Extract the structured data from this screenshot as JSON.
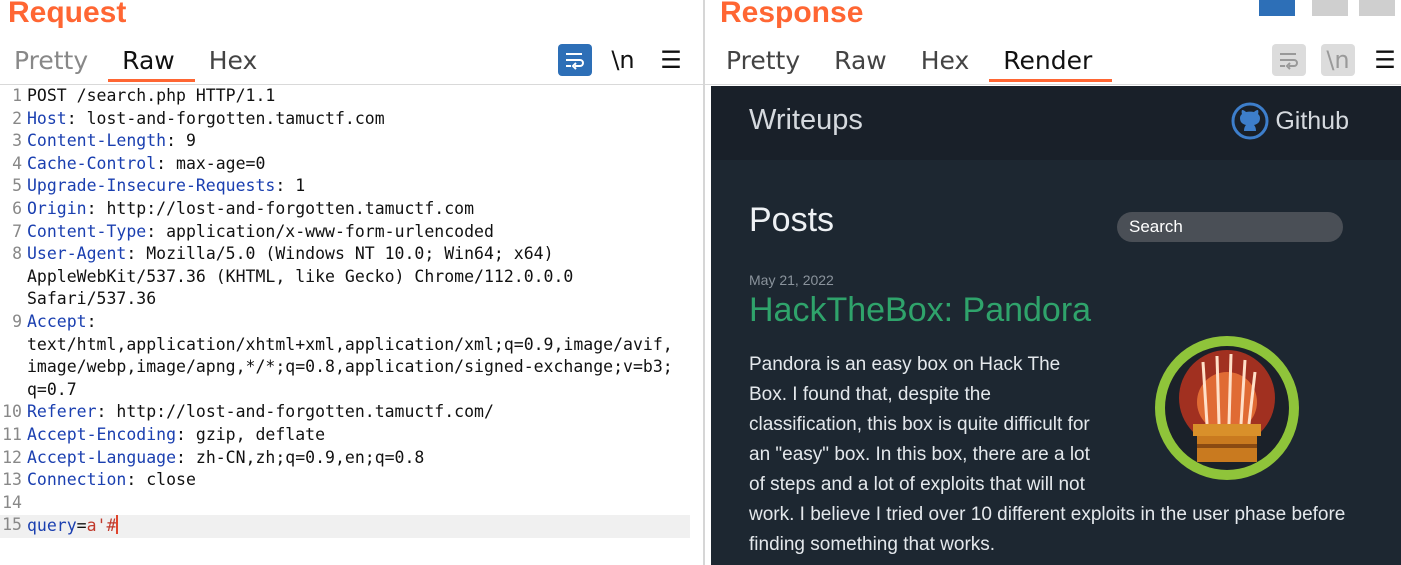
{
  "request": {
    "title": "Request",
    "tabs": [
      "Pretty",
      "Raw",
      "Hex"
    ],
    "active_tab": "Raw",
    "tools": {
      "wrap_icon": "wrap-lines-icon",
      "newline_label": "\\n",
      "menu_icon": "hamburger-menu-icon"
    },
    "lines": [
      {
        "n": "1",
        "parts": [
          [
            "",
            "POST /search.php HTTP/1.1"
          ]
        ]
      },
      {
        "n": "2",
        "parts": [
          [
            "h",
            "Host"
          ],
          [
            "",
            ": lost-and-forgotten.tamuctf.com"
          ]
        ]
      },
      {
        "n": "3",
        "parts": [
          [
            "h",
            "Content-Length"
          ],
          [
            "",
            ": 9"
          ]
        ]
      },
      {
        "n": "4",
        "parts": [
          [
            "h",
            "Cache-Control"
          ],
          [
            "",
            ": max-age=0"
          ]
        ]
      },
      {
        "n": "5",
        "parts": [
          [
            "h",
            "Upgrade-Insecure-Requests"
          ],
          [
            "",
            ": 1"
          ]
        ]
      },
      {
        "n": "6",
        "parts": [
          [
            "h",
            "Origin"
          ],
          [
            "",
            ": http://lost-and-forgotten.tamuctf.com"
          ]
        ]
      },
      {
        "n": "7",
        "parts": [
          [
            "h",
            "Content-Type"
          ],
          [
            "",
            ": application/x-www-form-urlencoded"
          ]
        ]
      },
      {
        "n": "8",
        "parts": [
          [
            "h",
            "User-Agent"
          ],
          [
            "",
            ": Mozilla/5.0 (Windows NT 10.0; Win64; x64)"
          ]
        ]
      },
      {
        "n": "",
        "parts": [
          [
            "",
            "AppleWebKit/537.36 (KHTML, like Gecko) Chrome/112.0.0.0"
          ]
        ]
      },
      {
        "n": "",
        "parts": [
          [
            "",
            "Safari/537.36"
          ]
        ]
      },
      {
        "n": "9",
        "parts": [
          [
            "h",
            "Accept"
          ],
          [
            "",
            ":"
          ]
        ]
      },
      {
        "n": "",
        "parts": [
          [
            "",
            "text/html,application/xhtml+xml,application/xml;q=0.9,image/avif,"
          ]
        ]
      },
      {
        "n": "",
        "parts": [
          [
            "",
            "image/webp,image/apng,*/*;q=0.8,application/signed-exchange;v=b3;"
          ]
        ]
      },
      {
        "n": "",
        "parts": [
          [
            "",
            "q=0.7"
          ]
        ]
      },
      {
        "n": "10",
        "parts": [
          [
            "h",
            "Referer"
          ],
          [
            "",
            ": http://lost-and-forgotten.tamuctf.com/"
          ]
        ]
      },
      {
        "n": "11",
        "parts": [
          [
            "h",
            "Accept-Encoding"
          ],
          [
            "",
            ": gzip, deflate"
          ]
        ]
      },
      {
        "n": "12",
        "parts": [
          [
            "h",
            "Accept-Language"
          ],
          [
            "",
            ": zh-CN,zh;q=0.9,en;q=0.8"
          ]
        ]
      },
      {
        "n": "13",
        "parts": [
          [
            "h",
            "Connection"
          ],
          [
            "",
            ": close"
          ]
        ]
      },
      {
        "n": "14",
        "parts": []
      },
      {
        "n": "15",
        "parts": [
          [
            "p",
            "query"
          ],
          [
            "",
            "="
          ],
          [
            "v",
            "a'#"
          ]
        ],
        "current": true
      }
    ]
  },
  "response": {
    "title": "Response",
    "tabs": [
      "Pretty",
      "Raw",
      "Hex",
      "Render"
    ],
    "active_tab": "Render",
    "tools": {
      "wrap_icon": "wrap-lines-icon",
      "newline_label": "\\n",
      "menu_icon": "hamburger-menu-icon"
    },
    "render": {
      "brand": "Writeups",
      "github_label": "Github",
      "posts_heading": "Posts",
      "search_placeholder": "Search",
      "post": {
        "date": "May 21, 2022",
        "title": "HackTheBox: Pandora",
        "body": "Pandora is an easy box on Hack The Box. I found that, despite the classification, this box is quite difficult for an \"easy\" box. In this box, there are a lot of steps and a lot of exploits that will not work. I believe I tried over 10 different exploits in the user phase before finding something that works."
      }
    }
  },
  "colors": {
    "accent": "#ff6633",
    "link": "#2fa36b",
    "header_name": "#1a3fb0",
    "param_value": "#c0392b",
    "render_bg": "#1d2731"
  }
}
